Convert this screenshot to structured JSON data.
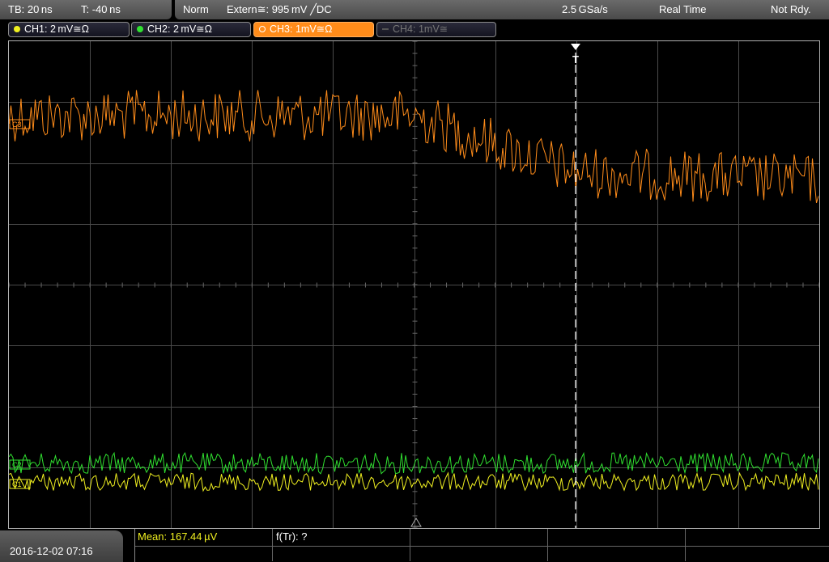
{
  "header": {
    "timebase": "TB: 20 ns",
    "trigger_time": "T: -40 ns",
    "trigger_mode": "Norm",
    "trigger_source": "Extern≅: 995 mV ╱DC",
    "sample_rate": "2.5 GSa/s",
    "acq_mode": "Real Time",
    "status": "Not Rdy."
  },
  "channels": [
    {
      "label": "CH1: 2 mV≅Ω",
      "color": "#f0f020",
      "active": false
    },
    {
      "label": "CH2: 2 mV≅Ω",
      "color": "#30e030",
      "active": false
    },
    {
      "label": "CH3: 1mV≅Ω",
      "color": "#ff8c1a",
      "active": true
    },
    {
      "label": "CH4: 1mV≅",
      "color": "#666666",
      "active": false
    }
  ],
  "markers": {
    "ch3": "C3",
    "ch2": "C2",
    "ch1": "C1",
    "trigger": "T"
  },
  "footer": {
    "datetime": "2016-12-02 07:16",
    "meas1": "Mean: 167.44 µV",
    "meas2": "f(Tr): ?"
  },
  "colors": {
    "ch1": "#f0f020",
    "ch2": "#30e030",
    "ch3": "#ff8c1a",
    "grid": "#4a4a4a",
    "meas_text": "#f0f020"
  }
}
